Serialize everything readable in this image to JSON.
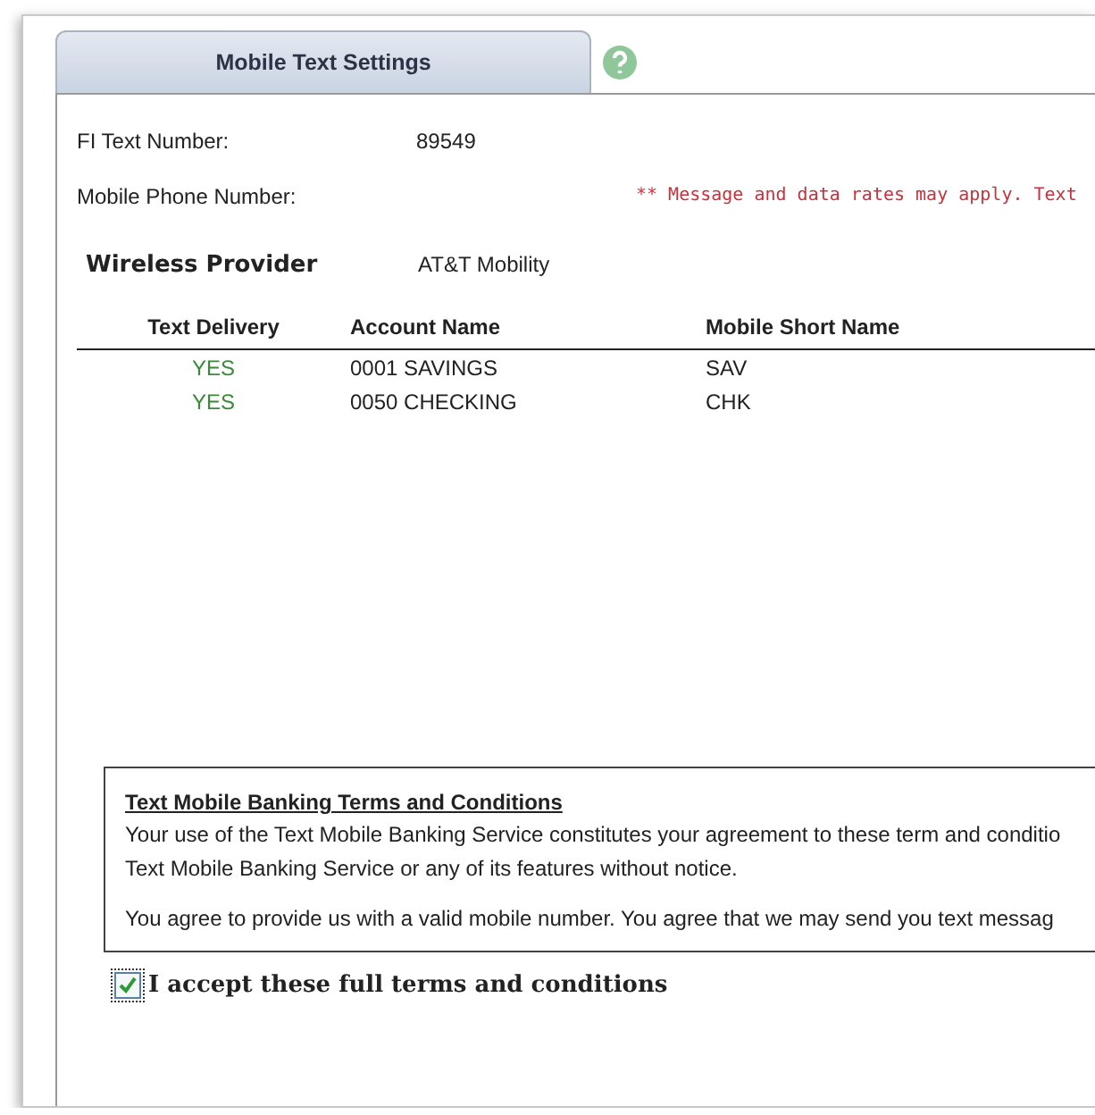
{
  "tab": {
    "label": "Mobile Text Settings",
    "selected": true
  },
  "fields": [
    {
      "label": "FI Text Number:",
      "value": "89549"
    },
    {
      "label": "Mobile Phone Number:",
      "note": "** Message and data rates may apply. Text"
    }
  ],
  "provider": {
    "label": "Wireless Provider",
    "value": "AT&T Mobility"
  },
  "table": {
    "columns": [
      "Text Delivery",
      "Account Name",
      "Mobile Short Name"
    ],
    "rows": [
      [
        "YES",
        "0001 SAVINGS",
        "SAV"
      ],
      [
        "YES",
        "0050 CHECKING",
        "CHK"
      ]
    ]
  },
  "terms": {
    "title": "Text Mobile Banking Terms and Conditions",
    "paragraphs": [
      "Your use of the Text Mobile Banking Service constitutes your agreement to these term and conditio\nText Mobile Banking Service or any of its features without notice.",
      "You agree to provide us with a valid mobile number. You agree that we may send you text messag"
    ]
  },
  "accept": {
    "label": "I accept these full terms and conditions",
    "checked": true
  }
}
